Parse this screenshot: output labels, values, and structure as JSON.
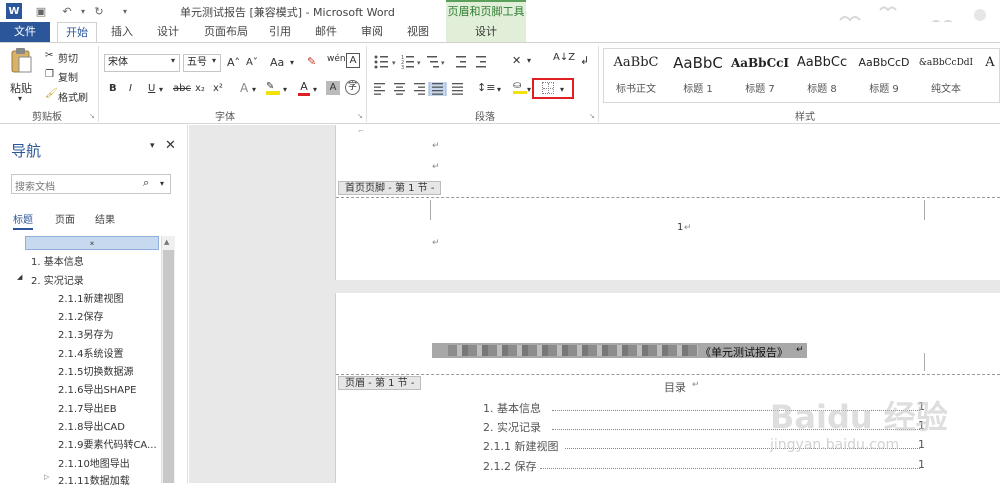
{
  "window": {
    "title": "单元测试报告 [兼容模式] - Microsoft Word",
    "context_group": "页眉和页脚工具"
  },
  "tabs": [
    "文件",
    "开始",
    "插入",
    "设计",
    "页面布局",
    "引用",
    "邮件",
    "审阅",
    "视图",
    "设计"
  ],
  "ribbon": {
    "clipboard": {
      "paste": "粘贴",
      "cut": "剪切",
      "copy": "复制",
      "format_painter": "格式刷",
      "label": "剪贴板"
    },
    "font": {
      "name": "宋体",
      "size": "五号",
      "label": "字体",
      "grow": "A˄",
      "shrink": "A˅",
      "case": "Aa",
      "bold": "B",
      "italic": "I",
      "underline": "U",
      "strike": "abc",
      "sub": "x₂",
      "sup": "x²"
    },
    "paragraph": {
      "label": "段落"
    },
    "styles": {
      "label": "样式",
      "items": [
        {
          "sample": "AaBbC",
          "name": "标书正文"
        },
        {
          "sample": "AaBbC",
          "name": "标题 1"
        },
        {
          "sample": "AaBbCcI",
          "name": "标题 7"
        },
        {
          "sample": "AaBbCc",
          "name": "标题 8"
        },
        {
          "sample": "AaBbCcD",
          "name": "标题 9"
        },
        {
          "sample": "&aBbCcDdI",
          "name": "纯文本"
        }
      ]
    }
  },
  "nav": {
    "title": "导航",
    "search_placeholder": "搜索文档",
    "tabs": [
      "标题",
      "页面",
      "结果"
    ],
    "items": [
      "1. 基本信息",
      "2. 实况记录",
      "2.1.1新建视图",
      "2.1.2保存",
      "2.1.3另存为",
      "2.1.4系统设置",
      "2.1.5切换数据源",
      "2.1.6导出SHAPE",
      "2.1.7导出EB",
      "2.1.8导出CAD",
      "2.1.9要素代码转CA...",
      "2.1.10地图导出",
      "2.1.11数据加载"
    ]
  },
  "document": {
    "footer_tag": "首页页脚 - 第 1 节 -",
    "page_number": "1",
    "header_tag": "页眉 - 第 1 节 -",
    "header_text": "《单元测试报告》",
    "toc_title": "目录",
    "toc": [
      {
        "text": "1. 基本信息",
        "page": "1"
      },
      {
        "text": "2. 实况记录",
        "page": "1"
      },
      {
        "text": "2.1.1 新建视图",
        "page": "1"
      },
      {
        "text": "2.1.2 保存",
        "page": "1"
      }
    ]
  },
  "watermark": "Baidu 经验",
  "watermark_url": "jingyan.baidu.com",
  "colors": {
    "accent": "#2b579a",
    "context": "#5aa05a",
    "highlight": "#e02020"
  }
}
